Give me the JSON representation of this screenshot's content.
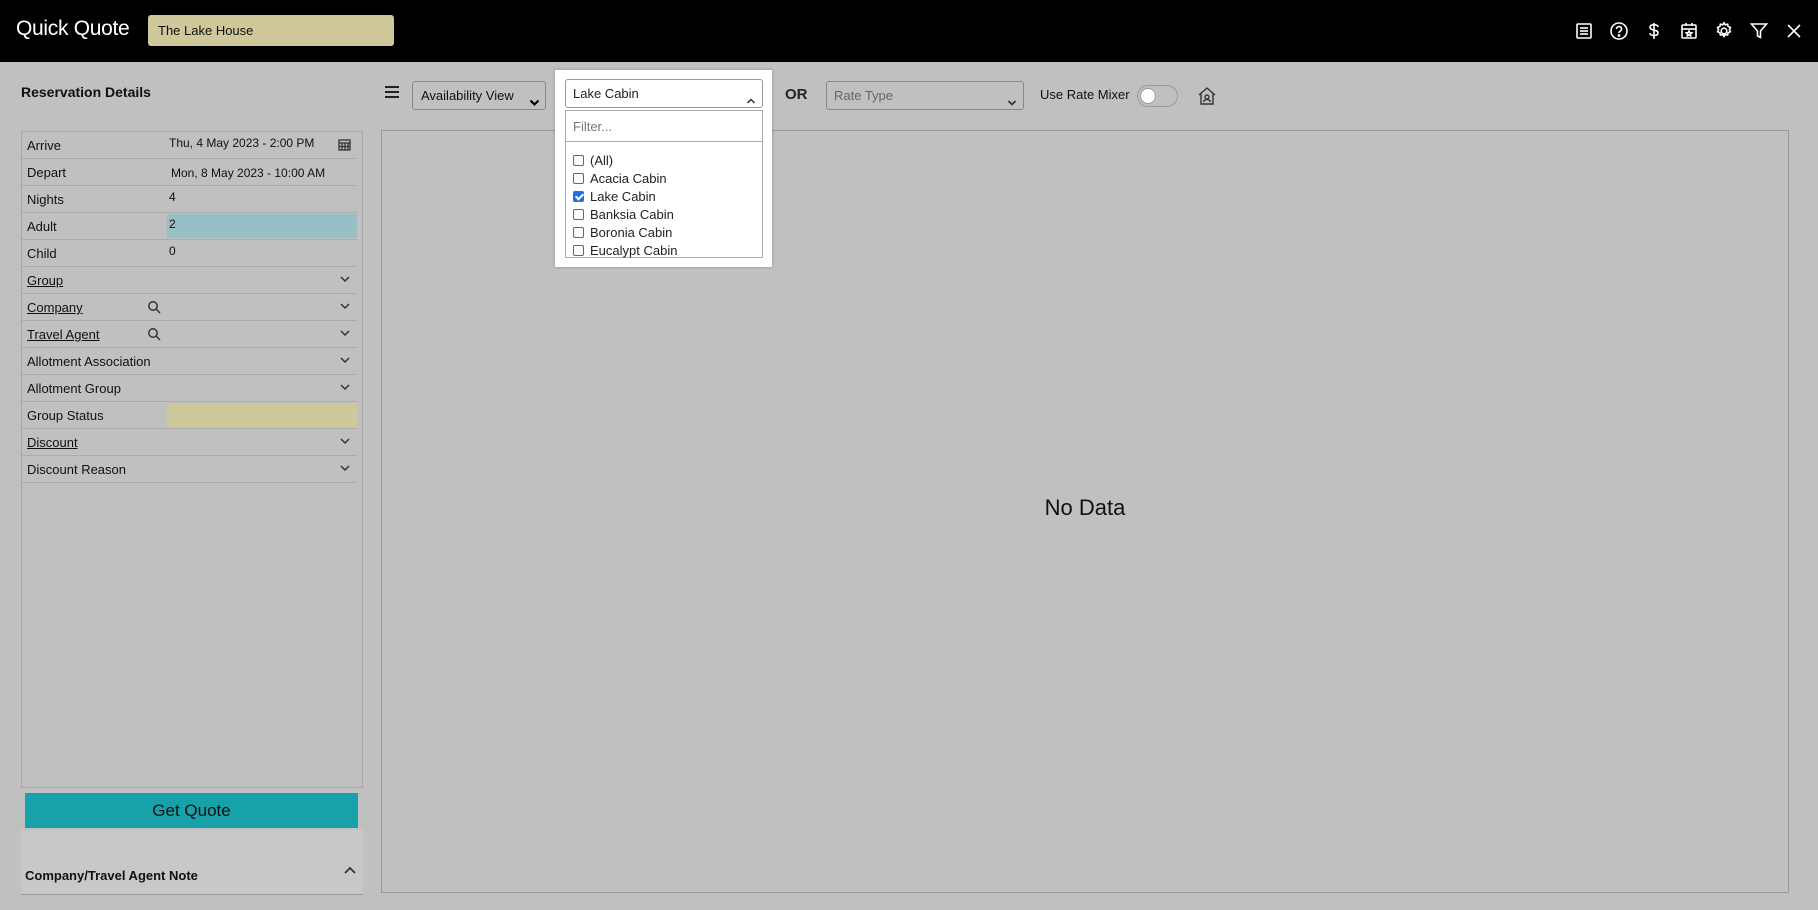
{
  "header": {
    "title": "Quick Quote",
    "property": "The Lake House",
    "icons": [
      "report-icon",
      "help-icon",
      "dollar-icon",
      "calendar-star-icon",
      "gear-icon",
      "filter-icon",
      "close-icon"
    ]
  },
  "reservation": {
    "heading": "Reservation Details",
    "rows": [
      {
        "label": "Arrive",
        "value": "Thu, 4 May 2023 - 2:00 PM"
      },
      {
        "label": "Depart",
        "value": "Mon, 8 May 2023 - 10:00 AM"
      },
      {
        "label": "Nights",
        "value": "4"
      },
      {
        "label": "Adult",
        "value": "2"
      },
      {
        "label": "Child",
        "value": "0"
      },
      {
        "label": "Group",
        "value": ""
      },
      {
        "label": "Company",
        "value": ""
      },
      {
        "label": "Travel Agent",
        "value": ""
      },
      {
        "label": "Allotment Association",
        "value": ""
      },
      {
        "label": "Allotment Group",
        "value": ""
      },
      {
        "label": "Group Status",
        "value": ""
      },
      {
        "label": "Discount",
        "value": ""
      },
      {
        "label": "Discount Reason",
        "value": ""
      }
    ],
    "get_quote": "Get Quote",
    "note_title": "Company/Travel Agent Note"
  },
  "toolbar": {
    "view_select": "Availability View",
    "or_label": "OR",
    "rate_type_placeholder": "Rate Type",
    "use_rate_mixer": "Use Rate Mixer",
    "rate_mixer_on": false
  },
  "area_dropdown": {
    "selected": "Lake Cabin",
    "filter_placeholder": "Filter...",
    "options": [
      {
        "label": "(All)",
        "checked": false
      },
      {
        "label": "Acacia Cabin",
        "checked": false
      },
      {
        "label": "Lake Cabin",
        "checked": true
      },
      {
        "label": "Banksia Cabin",
        "checked": false
      },
      {
        "label": "Boronia Cabin",
        "checked": false
      },
      {
        "label": "Eucalypt Cabin",
        "checked": false
      }
    ]
  },
  "main": {
    "empty_text": "No Data"
  }
}
